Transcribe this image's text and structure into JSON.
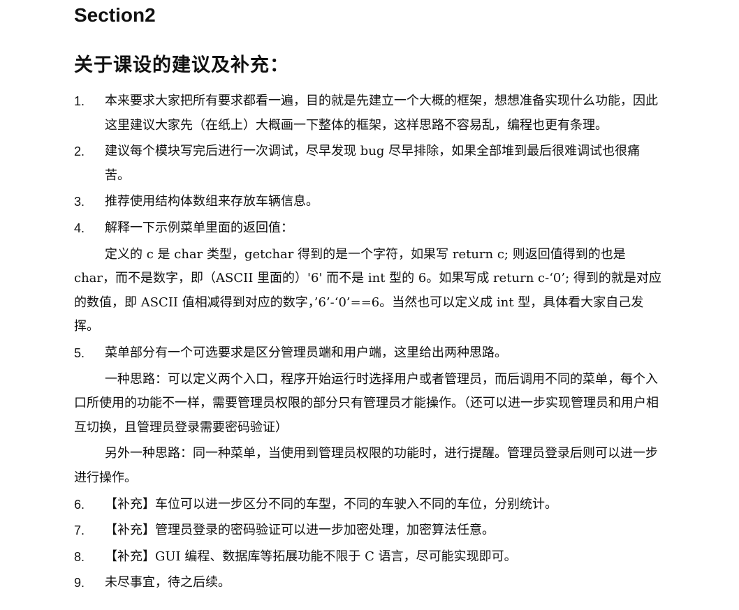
{
  "section_title": "Section2",
  "heading": "关于课设的建议及补充：",
  "items": [
    {
      "num": "1.",
      "text": "本来要求大家把所有要求都看一遍，目的就是先建立一个大概的框架，想想准备实现什么功能，因此这里建议大家先（在纸上）大概画一下整体的框架，这样思路不容易乱，编程也更有条理。"
    },
    {
      "num": "2.",
      "text": "建议每个模块写完后进行一次调试，尽早发现 bug 尽早排除，如果全部堆到最后很难调试也很痛苦。"
    },
    {
      "num": "3.",
      "text": "推荐使用结构体数组来存放车辆信息。"
    },
    {
      "num": "4.",
      "text": "解释一下示例菜单里面的返回值："
    }
  ],
  "para_4": "定义的 c 是 char 类型，getchar 得到的是一个字符，如果写 return c; 则返回值得到的也是 char，而不是数字，即（ASCII 里面的）'6' 而不是 int 型的 6。如果写成 return c-‘0’; 得到的就是对应的数值，即 ASCII 值相减得到对应的数字，’6’-‘0’==6。当然也可以定义成 int 型，具体看大家自己发挥。",
  "item_5": {
    "num": "5.",
    "text": "菜单部分有一个可选要求是区分管理员端和用户端，这里给出两种思路。"
  },
  "para_5a": "一种思路：可以定义两个入口，程序开始运行时选择用户或者管理员，而后调用不同的菜单，每个入口所使用的功能不一样，需要管理员权限的部分只有管理员才能操作。（还可以进一步实现管理员和用户相互切换，且管理员登录需要密码验证）",
  "para_5b": "另外一种思路：同一种菜单，当使用到管理员权限的功能时，进行提醒。管理员登录后则可以进一步进行操作。",
  "items_tail": [
    {
      "num": "6.",
      "text": "【补充】车位可以进一步区分不同的车型，不同的车驶入不同的车位，分别统计。"
    },
    {
      "num": "7.",
      "text": "【补充】管理员登录的密码验证可以进一步加密处理，加密算法任意。"
    },
    {
      "num": "8.",
      "text": "【补充】GUI 编程、数据库等拓展功能不限于 C 语言，尽可能实现即可。"
    },
    {
      "num": "9.",
      "text": "未尽事宜，待之后续。"
    }
  ]
}
